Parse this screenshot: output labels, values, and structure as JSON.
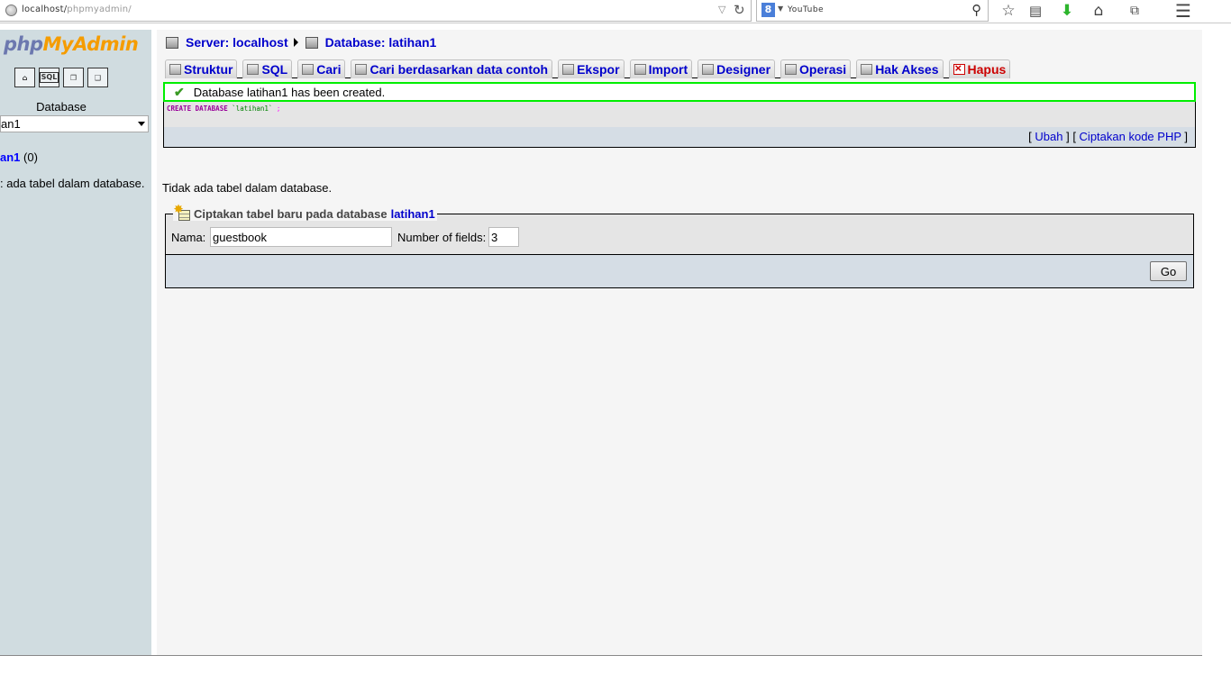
{
  "browser": {
    "url_host": "localhost/",
    "url_path": "phpmyadmin/",
    "search_engine_letter": "8",
    "search_text": "YouTube"
  },
  "left": {
    "logo_php": "php",
    "logo_my": "My",
    "logo_admin": "Admin",
    "icons": [
      "home-icon",
      "sql-icon",
      "query-window-icon",
      "docs-icon"
    ],
    "sql_icon_text": "SQL",
    "database_label": "Database",
    "selected_db": "an1",
    "tree_db": "an1",
    "tree_count": " (0)",
    "no_tables": ": ada tabel dalam database."
  },
  "breadcrumb": {
    "server": "Server: localhost",
    "database": "Database: latihan1"
  },
  "tabs": [
    {
      "label": "Struktur"
    },
    {
      "label": "SQL"
    },
    {
      "label": "Cari"
    },
    {
      "label": "Cari berdasarkan data contoh"
    },
    {
      "label": "Ekspor"
    },
    {
      "label": "Import"
    },
    {
      "label": "Designer"
    },
    {
      "label": "Operasi"
    },
    {
      "label": "Hak Akses"
    },
    {
      "label": "Hapus"
    }
  ],
  "success": {
    "message": "Database latihan1 has been created."
  },
  "sql": {
    "kw1": "CREATE DATABASE",
    "name": "`latihan1`",
    "end": " ;",
    "ubah": "Ubah",
    "php": "Ciptakan kode PHP"
  },
  "main": {
    "no_tables": "Tidak ada tabel dalam database."
  },
  "create": {
    "legend": "Ciptakan tabel baru pada database",
    "legend_db": "latihan1",
    "nama_label": "Nama:",
    "nama_value": "guestbook",
    "fields_label": "Number of fields:",
    "fields_value": "3",
    "go_label": "Go"
  },
  "colors": {
    "link": "#0000cc",
    "success_border": "#00ee00",
    "left_bg": "#d0dce0",
    "danger": "#cc0000"
  }
}
